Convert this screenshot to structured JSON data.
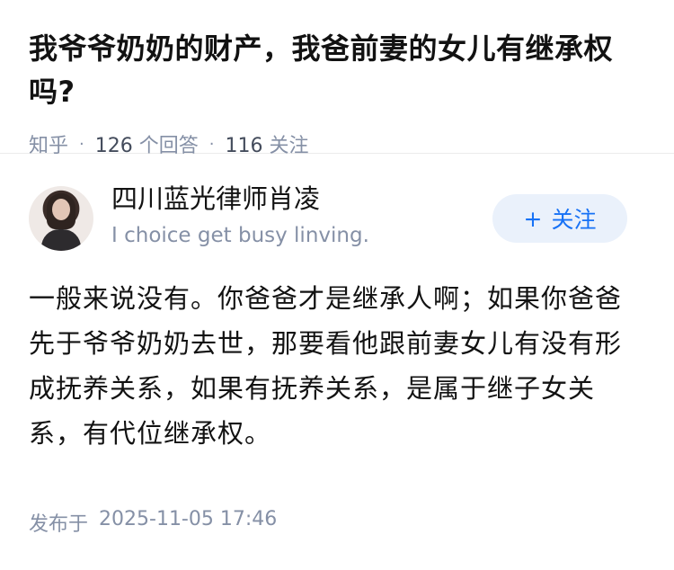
{
  "question": {
    "title": "我爷爷奶奶的财产，我爸前妻的女儿有继承权吗?",
    "source": "知乎",
    "answer_count": "126",
    "answer_label": "个回答",
    "follower_count": "116",
    "follower_label": "关注",
    "separator": "·"
  },
  "author": {
    "name": "四川蓝光律师肖凌",
    "bio": "I choice get busy linving.",
    "follow_label": "关注",
    "follow_icon": "+"
  },
  "answer": {
    "content": "一般来说没有。你爸爸才是继承人啊；如果你爸爸先于爷爷奶奶去世，那要看他跟前妻女儿有没有形成抚养关系，如果有抚养关系，是属于继子女关系，有代位继承权。"
  },
  "footer": {
    "published_label": "发布于",
    "published_time": "2025-11-05 17:46"
  }
}
